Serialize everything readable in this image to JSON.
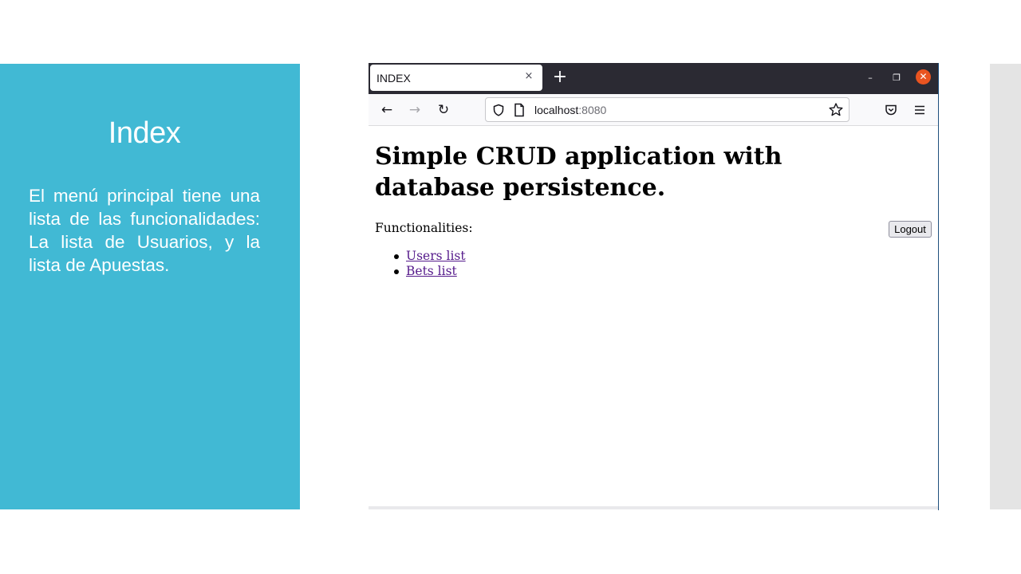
{
  "slide": {
    "title": "Index",
    "body": "El menú principal tiene una lista de las funcionalidades: La lista de Usuarios, y la lista de Apuestas."
  },
  "browser": {
    "tab_title": "INDEX",
    "url_host": "localhost",
    "url_port": ":8080",
    "icons": {
      "tab_close": "×",
      "new_tab": "+",
      "minimize": "–",
      "maximize": "❐",
      "close": "✕",
      "back": "←",
      "forward": "→",
      "reload": "↻"
    }
  },
  "page": {
    "heading": "Simple CRUD application with database persistence.",
    "functionalities_label": "Functionalities:",
    "logout_label": "Logout",
    "links": [
      {
        "label": "Users list"
      },
      {
        "label": "Bets list"
      }
    ]
  },
  "colors": {
    "slide_panel": "#41b9d4",
    "titlebar": "#2b2a33",
    "close_button": "#e95420",
    "visited_link": "#551a8b"
  }
}
